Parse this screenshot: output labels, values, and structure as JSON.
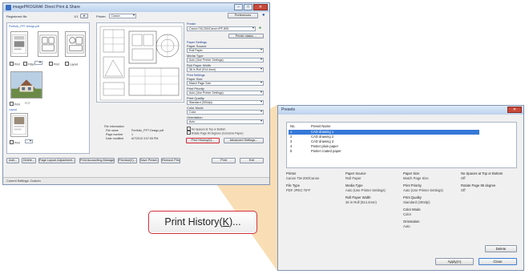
{
  "main_window": {
    "title": "imagePROGRAF Direct Print & Share",
    "buttons": {
      "minimize": "–",
      "maximize": "□",
      "close": "✕"
    },
    "registered_file_label": "Registered file",
    "registered_count": "1/1",
    "printer_label": "Printer",
    "printer_dropdown": "Canon",
    "preferences_button": "Preferences",
    "thumbnails": [
      {
        "name": "Portfolio_PPT Design.pdf"
      },
      {
        "name": "PDF"
      },
      {
        "name": "Excel"
      },
      {
        "name": "Word"
      },
      {
        "name": "PDF"
      },
      {
        "name": "Layout"
      }
    ],
    "thumb_checks": [
      "Print",
      "Fitted",
      "Print",
      "Layout"
    ],
    "preview_caption": "",
    "file_info": {
      "heading": "File information",
      "rows": [
        {
          "key": "File name",
          "value": "Portfolio_PPT Design.pdf"
        },
        {
          "key": "Page number",
          "value": "1"
        },
        {
          "key": "Date modified",
          "value": "6/7/2010 3:07:05 PM"
        }
      ]
    },
    "settings": {
      "printer_heading": "Printer",
      "printer_value": "Canon TM-200/Canon iPF-805",
      "printer_button": "Printer status ...",
      "paper_settings": "Paper Settings",
      "paper_source_label": "Paper Source",
      "paper_source_value": "Roll Paper",
      "media_type_label": "Media Type",
      "media_type_value": "Auto (Use Printer Settings)",
      "roll_width_label": "Roll Paper Width",
      "roll_width_value": "36 in Roll (914.4mm)",
      "print_settings": "Print Settings",
      "paper_size_label": "Paper Size",
      "paper_size_value": "Match Page Size",
      "print_priority_label": "Print Priority",
      "print_priority_value": "Auto (Use Printer Settings)",
      "print_quality_label": "Print Quality",
      "print_quality_value": "Standard (300dpi)",
      "color_mode_label": "Color Mode",
      "color_mode_value": "Color",
      "orientation_label": "Orientation",
      "orientation_value": "Auto",
      "check_1": "No Spaces at Top or Bottom",
      "check_2": "Rotate Page 90 degrees (Conserve Paper)",
      "print_history_button": "Print History(K)...",
      "advanced_button": "Advanced Settings..."
    },
    "bottom_buttons": {
      "add": "Add...",
      "delete": "Delete...",
      "page_layout": "Page Layout Adjustment...",
      "print_accounting": "Print Accounting Manager...",
      "preview": "Preview(V)...",
      "save_preset": "Save Preset...",
      "remove_print": "Remove Print...",
      "print": "Print",
      "exit": "Exit"
    },
    "status_text": "Current Settings: Custom"
  },
  "callout": {
    "label_prefix": "Print History(",
    "label_key": "K",
    "label_suffix": ")..."
  },
  "presets_dialog": {
    "title": "Presets",
    "close": "✕",
    "columns": {
      "no": "No.",
      "name": "Preset Name"
    },
    "rows": [
      {
        "no": "1",
        "name": "CAD drawing 1",
        "selected": true
      },
      {
        "no": "2",
        "name": "CAD drawing 2",
        "selected": false
      },
      {
        "no": "3",
        "name": "CAD drawing 3",
        "selected": false
      },
      {
        "no": "4",
        "name": "Poster plain paper",
        "selected": false
      },
      {
        "no": "5",
        "name": "Poster coated paper",
        "selected": false
      }
    ],
    "info": {
      "printer_k": "Printer",
      "printer_v": "Canon TM-200/Canon",
      "paper_source_k": "Paper Source",
      "paper_source_v": "Roll Paper",
      "paper_size_k": "Paper Size",
      "paper_size_v": "Match Page Size",
      "no_spaces_k": "No Spaces at Top or Bottom",
      "no_spaces_v": "Off",
      "file_type_k": "File Type",
      "file_type_v": "PDF JPEG TIFF",
      "media_type_k": "Media Type",
      "media_type_v": "Auto (Use Printer Settings)",
      "print_priority_k": "Print Priority",
      "print_priority_v": "Auto (Use Printer Settings)",
      "rotate_k": "Rotate Page 90 degree",
      "rotate_v": "Off",
      "roll_width_k": "Roll Paper Width",
      "roll_width_v": "36 in Roll (914.4mm)",
      "print_quality_k": "Print Quality",
      "print_quality_v": "Standard (300dpi)",
      "color_mode_k": "Color Mode",
      "color_mode_v": "Color",
      "orientation_k": "Orientation",
      "orientation_v": "Auto"
    },
    "delete_button": "Delete",
    "apply_button": "Apply(A)",
    "close_button": "Close"
  },
  "colors": {
    "accent": "#3478d8",
    "callout_border": "#d12f3c",
    "beam": "#f5c98a"
  }
}
